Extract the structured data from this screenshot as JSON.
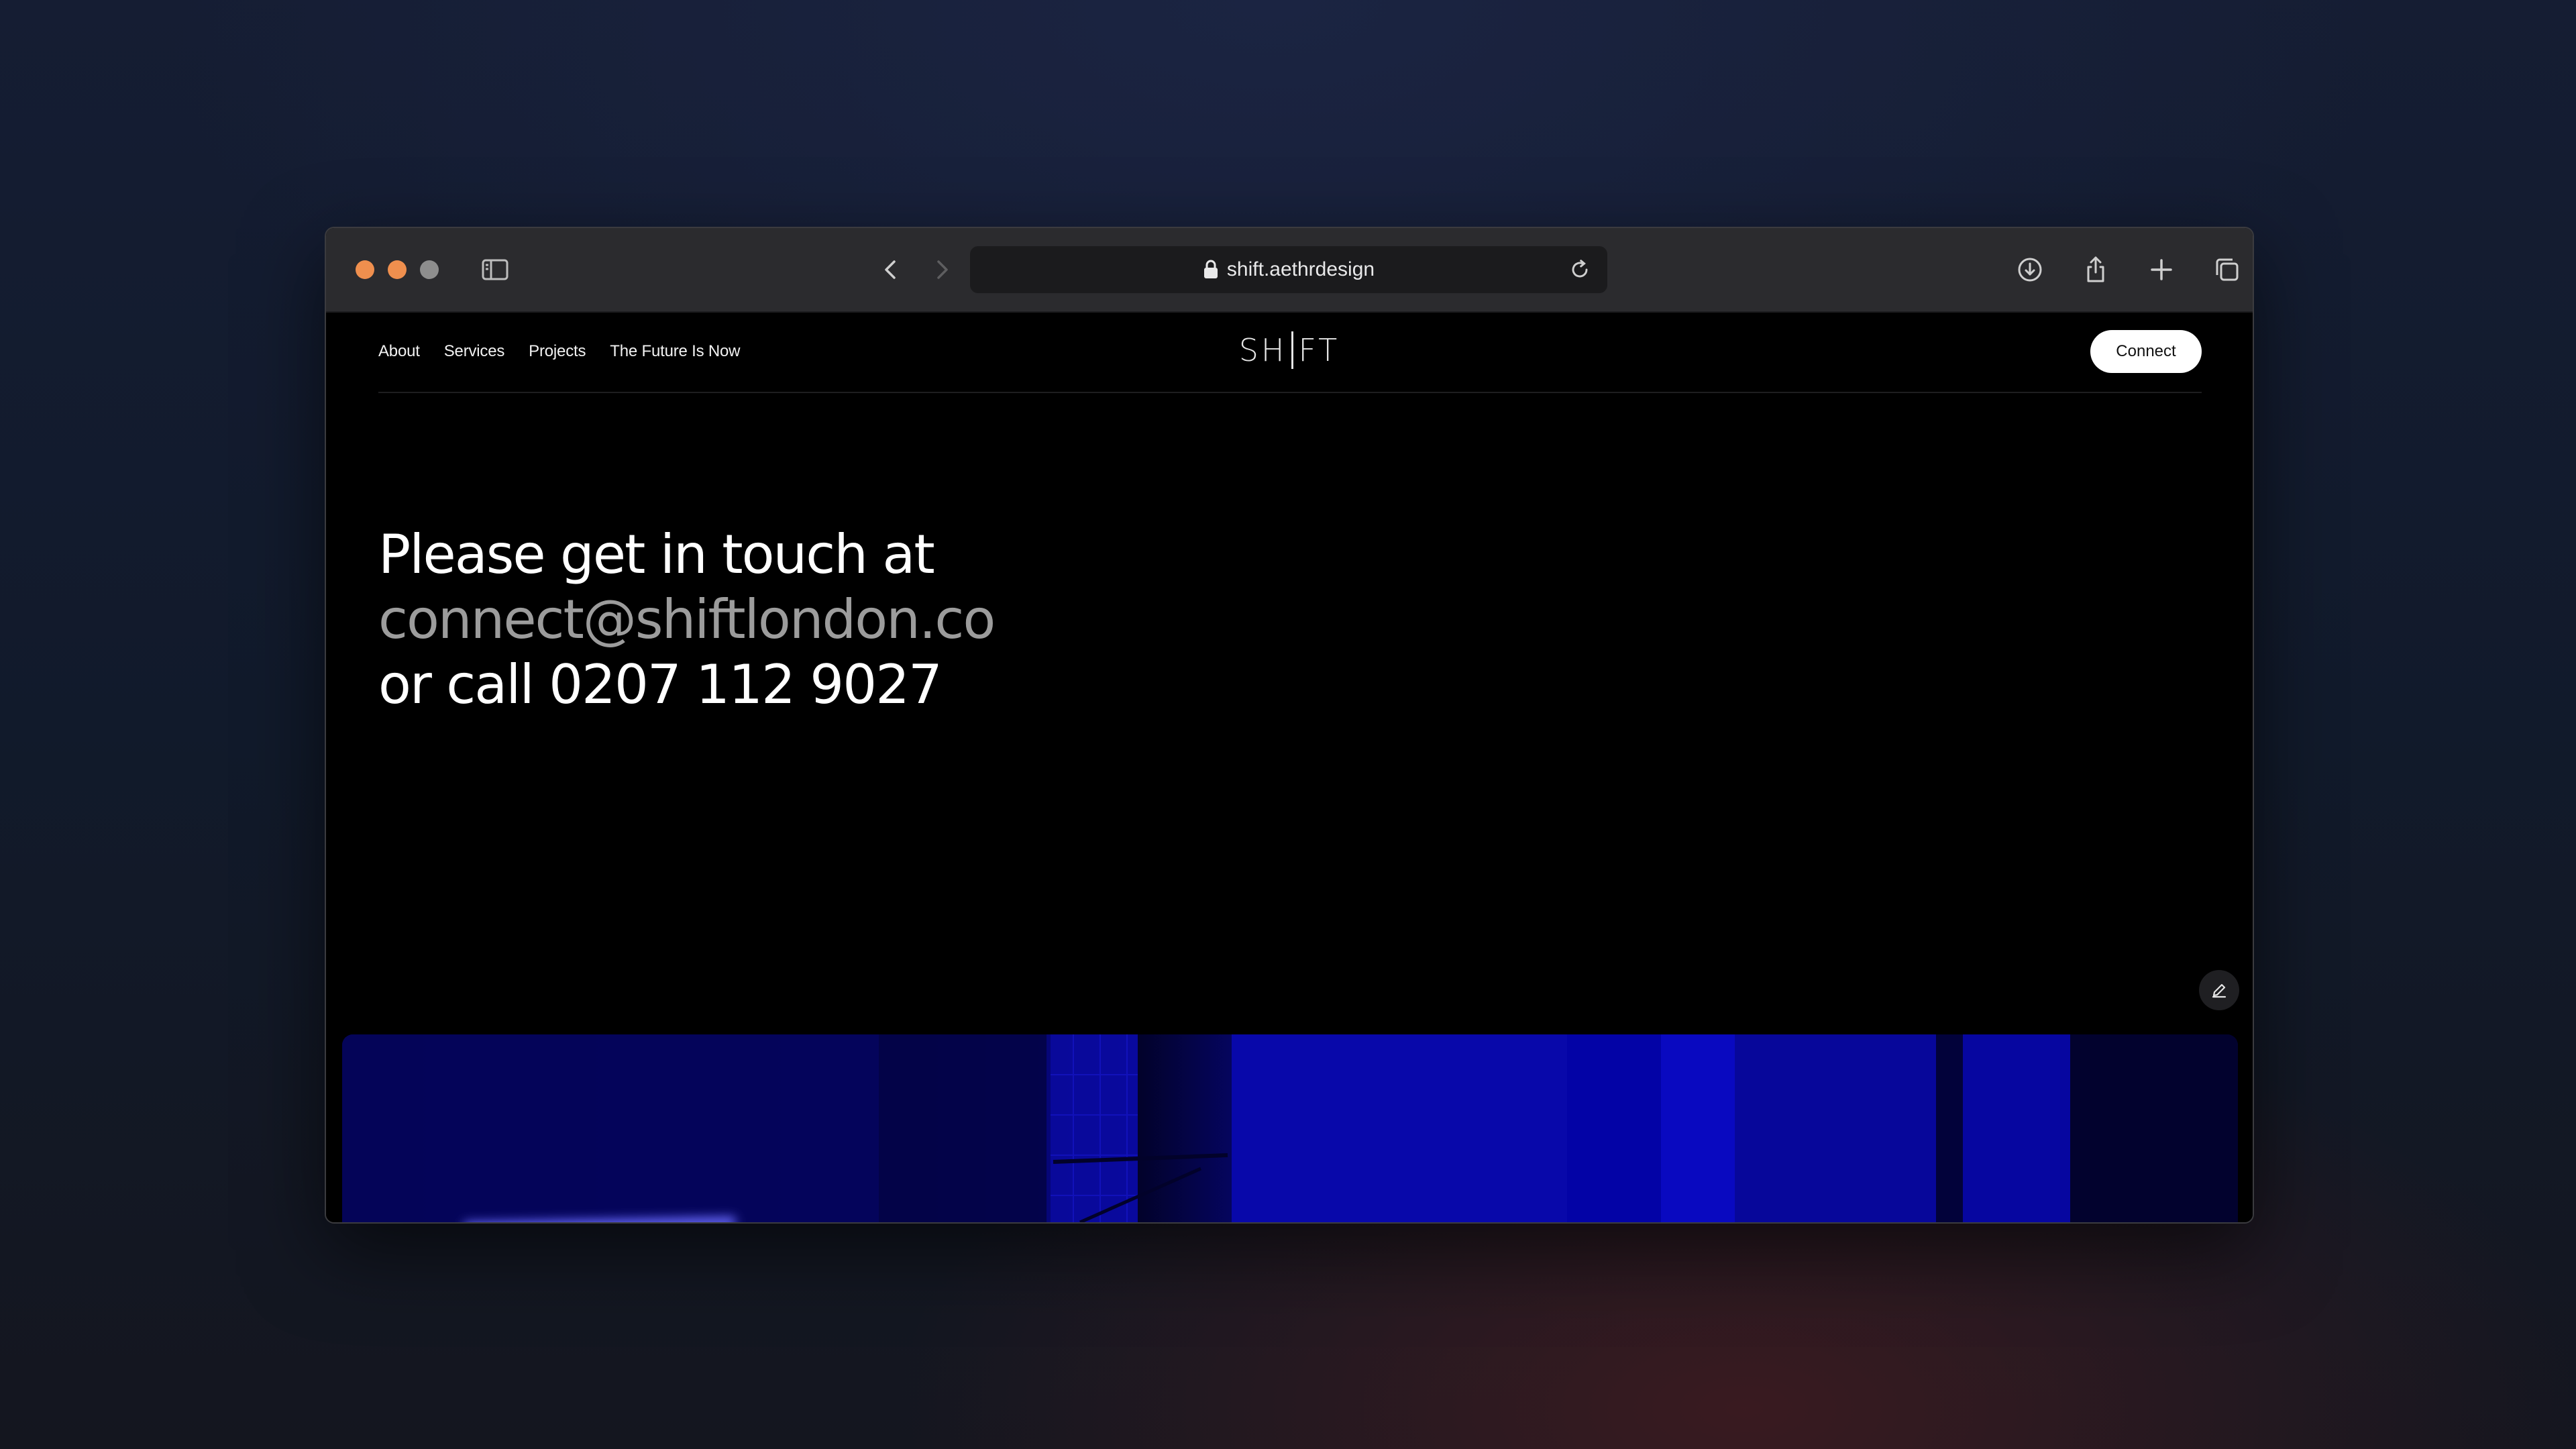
{
  "browser": {
    "url": "shift.aethrdesign"
  },
  "site": {
    "nav": [
      {
        "label": "About"
      },
      {
        "label": "Services"
      },
      {
        "label": "Projects"
      },
      {
        "label": "The Future Is Now"
      }
    ],
    "logo_left": "SH",
    "logo_right": "FT",
    "connect_label": "Connect"
  },
  "hero": {
    "line1": "Please get in touch at",
    "email": "connect@shiftlondon.co",
    "line3": "or call 0207 112 9027"
  },
  "colors": {
    "accent_blue": "#0a0ad0",
    "email_gray": "#9c9c9c",
    "traffic_orange": "#ef8f4e"
  },
  "icons": {
    "sidebar": "sidebar-icon",
    "back": "chevron-left-icon",
    "forward": "chevron-right-icon",
    "shield": "shield-icon",
    "lock": "lock-icon",
    "reload": "reload-icon",
    "download": "download-icon",
    "share": "share-icon",
    "new_tab": "plus-icon",
    "tabs": "tabs-icon",
    "edit": "pencil-icon"
  }
}
